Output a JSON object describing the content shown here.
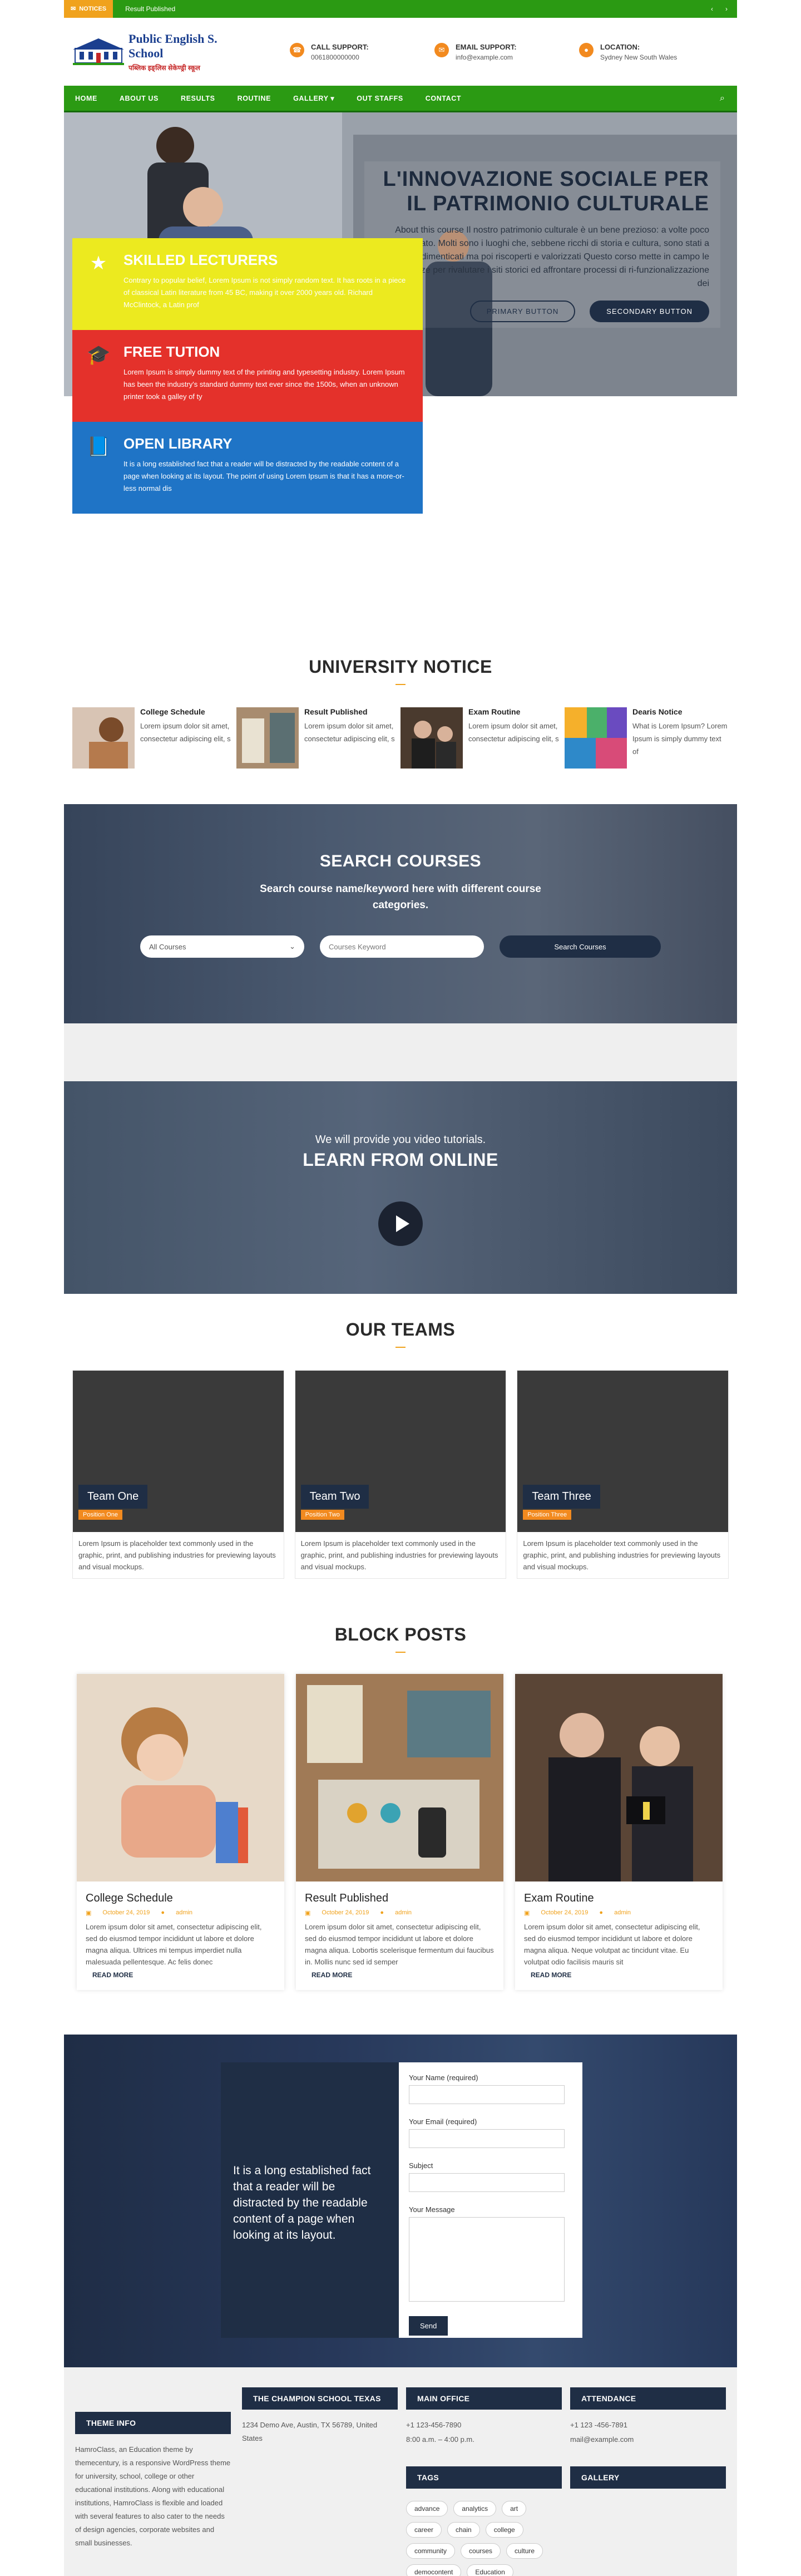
{
  "notice_bar": {
    "label": "NOTICES",
    "text": "Result Published",
    "prev": "‹",
    "next": "›"
  },
  "header": {
    "school_name": "Public English S. School",
    "school_tagline": "पब्लिक इङ्लिस सेकेण्ड्री स्कूल",
    "call_label": "CALL SUPPORT:",
    "call_value": "0061800000000",
    "email_label": "EMAIL SUPPORT:",
    "email_value": "info@example.com",
    "location_label": "LOCATION:",
    "location_value": "Sydney New South Wales"
  },
  "nav": {
    "items": [
      "HOME",
      "ABOUT US",
      "RESULTS",
      "ROUTINE",
      "GALLERY",
      "OUT STAFFS",
      "CONTACT"
    ],
    "gallery_caret": "▾"
  },
  "hero": {
    "title": "L'INNOVAZIONE SOCIALE PER IL PATRIMONIO CULTURALE",
    "description": "About this course Il nostro patrimonio culturale è un bene prezioso: a volte poco valorizzato. Molti sono i luoghi che, sebbene ricchi di storia e cultura, sono stati a lungo dimenticati ma poi riscoperti e valorizzati Questo corso mette in campo le competenze per rivalutare i siti storici ed affrontare processi di ri-funzionalizzazione dei",
    "primary_button": "PRIMARY BUTTON",
    "secondary_button": "SECONDARY BUTTON"
  },
  "features": [
    {
      "title": "SKILLED LECTURERS",
      "text": "Contrary to popular belief, Lorem Ipsum is not simply random text. It has roots in a piece of classical Latin literature from 45 BC, making it over 2000 years old. Richard McClintock, a Latin prof",
      "icon": "star-icon",
      "color": "#ecea1f"
    },
    {
      "title": "FREE TUTION",
      "text": "Lorem Ipsum is simply dummy text of the printing and typesetting industry. Lorem Ipsum has been the industry's standard dummy text ever since the 1500s, when an unknown printer took a galley of ty",
      "icon": "graduation-cap-icon",
      "color": "#e4312b"
    },
    {
      "title": "OPEN LIBRARY",
      "text": "It is a long established fact that a reader will be distracted by the readable content of a page when looking at its layout. The point of using Lorem Ipsum is that it has a more-or-less normal dis",
      "icon": "book-icon",
      "color": "#1f74c6"
    }
  ],
  "university_notice": {
    "title": "UNIVERSITY NOTICE",
    "items": [
      {
        "title": "College Schedule",
        "text": "Lorem ipsum dolor sit amet, consectetur adipiscing elit, s"
      },
      {
        "title": "Result Published",
        "text": "Lorem ipsum dolor sit amet, consectetur adipiscing elit, s"
      },
      {
        "title": "Exam Routine",
        "text": "Lorem ipsum dolor sit amet, consectetur adipiscing elit, s"
      },
      {
        "title": "Dearis Notice",
        "text": "What is Lorem Ipsum? Lorem Ipsum is simply dummy text of"
      }
    ]
  },
  "search_courses": {
    "title": "SEARCH COURSES",
    "subtitle": "Search course name/keyword here with different course categories.",
    "select_value": "All Courses",
    "input_placeholder": "Courses Keyword",
    "button": "Search Courses"
  },
  "video": {
    "small": "We will provide you video tutorials.",
    "big": "LEARN FROM ONLINE"
  },
  "teams": {
    "title": "OUR TEAMS",
    "items": [
      {
        "name": "Team One",
        "position": "Position One",
        "desc": "Lorem Ipsum is placeholder text commonly used in the graphic, print, and publishing industries for previewing layouts and visual mockups."
      },
      {
        "name": "Team Two",
        "position": "Position Two",
        "desc": "Lorem Ipsum is placeholder text commonly used in the graphic, print, and publishing industries for previewing layouts and visual mockups."
      },
      {
        "name": "Team Three",
        "position": "Position Three",
        "desc": "Lorem Ipsum is placeholder text commonly used in the graphic, print, and publishing industries for previewing layouts and visual mockups."
      }
    ]
  },
  "posts": {
    "title": "BLOCK POSTS",
    "items": [
      {
        "title": "College Schedule",
        "date": "October 24, 2019",
        "author": "admin",
        "text": "Lorem ipsum dolor sit amet, consectetur adipiscing elit, sed do eiusmod tempor incididunt ut labore et dolore magna aliqua. Ultrices mi tempus imperdiet nulla malesuada pellentesque. Ac felis donec",
        "more": "READ MORE"
      },
      {
        "title": "Result Published",
        "date": "October 24, 2019",
        "author": "admin",
        "text": "Lorem ipsum dolor sit amet, consectetur adipiscing elit, sed do eiusmod tempor incididunt ut labore et dolore magna aliqua. Lobortis scelerisque fermentum dui faucibus in. Mollis nunc sed id semper",
        "more": "READ MORE"
      },
      {
        "title": "Exam Routine",
        "date": "October 24, 2019",
        "author": "admin",
        "text": "Lorem ipsum dolor sit amet, consectetur adipiscing elit, sed do eiusmod tempor incididunt ut labore et dolore magna aliqua. Neque volutpat ac tincidunt vitae. Eu volutpat odio facilisis mauris sit",
        "more": "READ MORE"
      }
    ]
  },
  "contact": {
    "quote": "It is a long established fact that a reader will be distracted by the readable content of a page when looking at its layout.",
    "name_label": "Your Name (required)",
    "email_label": "Your Email (required)",
    "subject_label": "Subject",
    "message_label": "Your Message",
    "send": "Send"
  },
  "footer": {
    "theme_info_title": "THEME INFO",
    "theme_info_text": "HamroClass, an Education theme by themecentury, is a responsive WordPress theme for university, school, college or other educational institutions. Along with educational institutions, HamroClass is flexible and loaded with several features to also cater to the needs of design agencies, corporate websites and small businesses.",
    "school_title": "THE CHAMPION SCHOOL TEXAS",
    "school_address": "1234 Demo Ave, Austin, TX 56789, United States",
    "main_office_title": "MAIN OFFICE",
    "main_office_phone": "+1 123-456-7890",
    "main_office_hours": "8:00 a.m. – 4:00 p.m.",
    "attendance_title": "ATTENDANCE",
    "attendance_phone": "+1 123 -456-7891",
    "attendance_email": "mail@example.com",
    "tags_title": "TAGS",
    "tags": [
      "advance",
      "analytics",
      "art",
      "career",
      "chain",
      "college",
      "community",
      "courses",
      "culture",
      "democontent",
      "Education"
    ],
    "gallery_title": "GALLERY"
  },
  "colors": {
    "green": "#2b9a13",
    "orange": "#f0a21d",
    "navy": "#1f2e45",
    "yellow": "#ecea1f",
    "red": "#e4312b",
    "blue": "#1f74c6"
  }
}
